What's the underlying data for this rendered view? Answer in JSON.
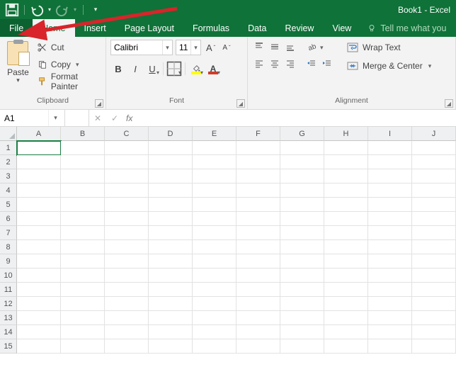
{
  "title": "Book1 - Excel",
  "qat": {
    "save": "save",
    "undo": "undo",
    "redo": "redo"
  },
  "tabs": {
    "file": "File",
    "home": "Home",
    "insert": "Insert",
    "page_layout": "Page Layout",
    "formulas": "Formulas",
    "data": "Data",
    "review": "Review",
    "view": "View",
    "tell_me": "Tell me what you"
  },
  "clipboard": {
    "paste": "Paste",
    "cut": "Cut",
    "copy": "Copy",
    "format_painter": "Format Painter",
    "group_label": "Clipboard"
  },
  "font": {
    "name": "Calibri",
    "size": "11",
    "group_label": "Font",
    "increase_hint": "A",
    "decrease_hint": "A",
    "bold": "B",
    "italic": "I",
    "underline": "U",
    "fontcolor": "A",
    "fill_color": "#ffff00",
    "font_color": "#d13b2a"
  },
  "alignment": {
    "wrap": "Wrap Text",
    "merge": "Merge & Center",
    "group_label": "Alignment"
  },
  "formula_bar": {
    "name_box": "A1",
    "fx": "fx",
    "value": ""
  },
  "grid": {
    "columns": [
      "A",
      "B",
      "C",
      "D",
      "E",
      "F",
      "G",
      "H",
      "I",
      "J"
    ],
    "rows": [
      "1",
      "2",
      "3",
      "4",
      "5",
      "6",
      "7",
      "8",
      "9",
      "10",
      "11",
      "12",
      "13",
      "14",
      "15"
    ],
    "active_cell": "A1"
  }
}
